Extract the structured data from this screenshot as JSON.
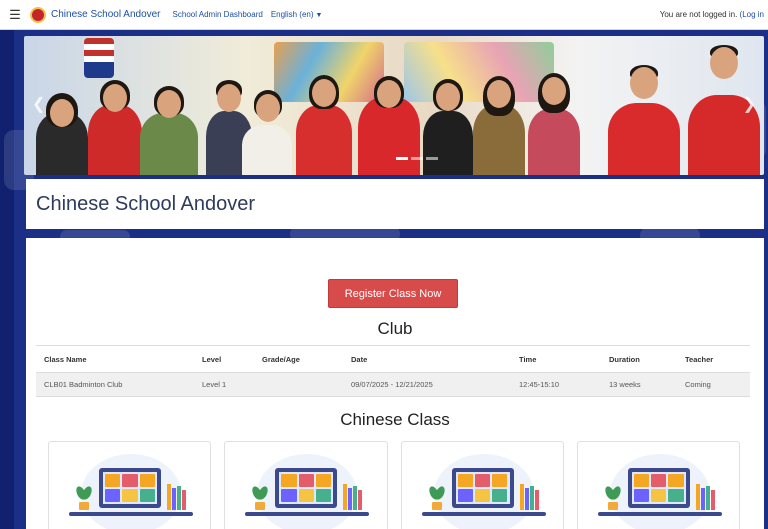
{
  "nav": {
    "site_name": "Chinese School Andover",
    "links": [
      "School Admin Dashboard",
      "English (en)"
    ],
    "login_status": "You are not logged in.",
    "login_link": "(Log in"
  },
  "title": "Chinese School Andover",
  "register_button": "Register Class Now",
  "club": {
    "heading": "Club",
    "columns": [
      "Class Name",
      "Level",
      "Grade/Age",
      "Date",
      "Time",
      "Duration",
      "Teacher"
    ],
    "rows": [
      [
        "CLB01 Badminton Club",
        "Level 1",
        "",
        "09/07/2025 - 12/21/2025",
        "12:45-15:10",
        "13 weeks",
        "Coming"
      ]
    ]
  },
  "chinese_class": {
    "heading": "Chinese Class",
    "card_count": 4
  },
  "icons": {
    "menu": "hamburger-menu-icon",
    "logo": "school-logo-icon",
    "dropdown": "chevron-down-icon",
    "carousel_prev": "chevron-left-icon",
    "carousel_next": "chevron-right-icon"
  },
  "colors": {
    "background": "#1b2f86",
    "accent_button": "#d84b4b",
    "link": "#1e4fa3"
  }
}
